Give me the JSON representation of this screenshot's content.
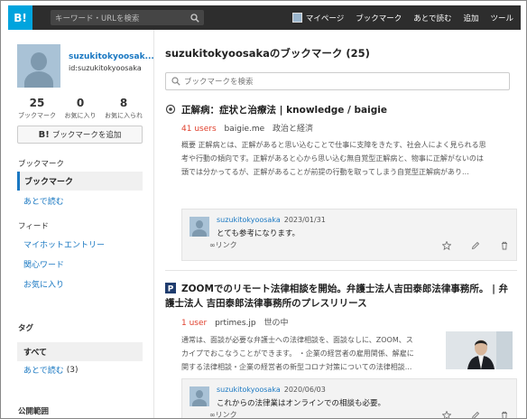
{
  "header": {
    "logo": "B!",
    "search_placeholder": "キーワード・URLを検索",
    "links": [
      "マイページ",
      "ブックマーク",
      "あとで読む",
      "追加",
      "ツール"
    ]
  },
  "profile": {
    "username": "suzukitokyoosak...",
    "id": "id:suzukitokyoosaka",
    "stats": [
      {
        "value": "25",
        "label": "ブックマーク"
      },
      {
        "value": "0",
        "label": "お気に入り"
      },
      {
        "value": "8",
        "label": "お気に入られ"
      }
    ],
    "add_button_icon": "B!",
    "add_button_label": "ブックマークを追加"
  },
  "sidebar": {
    "bookmark_heading": "ブックマーク",
    "bookmark_items": [
      "ブックマーク",
      "あとで読む"
    ],
    "feed_heading": "フィード",
    "feed_items": [
      "マイホットエントリー",
      "関心ワード",
      "お気に入り"
    ],
    "tag_heading": "タグ",
    "tag_all": "すべて",
    "tag_item": "あとで読む",
    "tag_item_count": "(3)",
    "public_heading": "公開範囲"
  },
  "main": {
    "title": "suzukitokyoosakaのブックマーク (25)",
    "search_placeholder": "ブックマークを検索",
    "entries": [
      {
        "title": "正解病：症状と治療法 | knowledge / baigie",
        "users": "41 users",
        "site": "baigie.me",
        "category": "政治と経済",
        "desc": [
          "概要 正解病とは、正解があると思い込むことで仕事に支障をきたす、社会人によく見られる思",
          "考や行動の傾向です。正解があると心から思い込む無自覚型正解病と、物事に正解がないのは",
          "頭では分かってるが、正解があることが前提の行動を取ってしまう自覚型正解病があり..."
        ],
        "comment_user": "suzukitokyoosaka",
        "comment_date": "2023/01/31",
        "comment_text": "とても参考になります。",
        "link_label": "リンク"
      },
      {
        "title": "ZOOMでのリモート法律相談を開始。弁護士法人吉田泰郎法律事務所。 | 弁護士法人 吉田泰郎法律事務所のプレスリリース",
        "users": "1 user",
        "site": "prtimes.jp",
        "category": "世の中",
        "desc": [
          "通常は、面談が必要な弁護士への法律相談を、面談なしに、ZOOM、ス",
          "カイプでおこなうことができます。 ・企業の経営者の雇用関係、解雇に",
          "関する法律相談・企業の経営者の新型コロナ対策についての法律相談..."
        ],
        "comment_user": "suzukitokyoosaka",
        "comment_date": "2020/06/03",
        "comment_text": "これからの法律業はオンラインでの相談も必要。",
        "link_label": "リンク"
      }
    ]
  },
  "colors": {
    "accent": "#1a78c2",
    "users": "#e0412e",
    "logo": "#00a4de",
    "topbar": "#2d2d2d"
  }
}
